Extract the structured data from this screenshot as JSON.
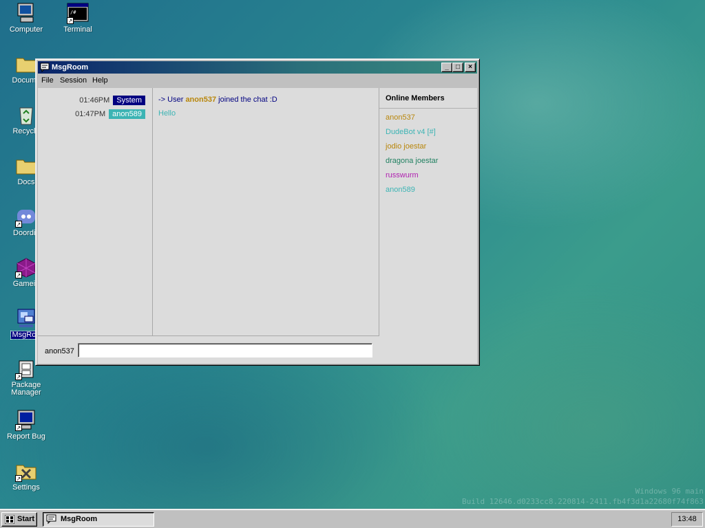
{
  "desktop": {
    "icons": [
      {
        "label": "Computer",
        "icon": "computer-icon"
      },
      {
        "label": "Terminal",
        "icon": "terminal-icon"
      },
      {
        "label": "Docume",
        "icon": "folder-icon"
      },
      {
        "label": "Recycle",
        "icon": "recycle-bin-icon"
      },
      {
        "label": "Docs",
        "icon": "folder-icon"
      },
      {
        "label": "Doordis",
        "icon": "discord-icon"
      },
      {
        "label": "Gamein",
        "icon": "game-icon"
      },
      {
        "label": "MsgRoo",
        "icon": "msgroom-icon"
      },
      {
        "label": "Package Manager",
        "icon": "package-manager-icon"
      },
      {
        "label": "Report Bug",
        "icon": "report-bug-icon"
      },
      {
        "label": "Settings",
        "icon": "settings-icon"
      }
    ],
    "watermark": {
      "line1": "Windows 96 main",
      "line2": "Build 12646.d0233cc8.220814-2411.fb4f3d1a22680f74f863"
    }
  },
  "window": {
    "title": "MsgRoom",
    "title_icon": "chat-bubble-icon",
    "controls": {
      "minimize": "_",
      "maximize": "□",
      "close": "×"
    },
    "menu": [
      "File",
      "Session",
      "Help"
    ],
    "messages": [
      {
        "time": "01:46PM",
        "author": "System",
        "author_color": "#000080",
        "prefix": "-> User ",
        "user": "anon537",
        "user_color": "#b8860b",
        "suffix": " joined the chat :D",
        "text_color": "#000080"
      },
      {
        "time": "01:47PM",
        "author": "anon589",
        "author_color": "#3cb4b4",
        "text": "Hello",
        "text_color": "#3cb4b4"
      }
    ],
    "members_title": "Online Members",
    "members": [
      {
        "name": "anon537",
        "color": "#b8860b"
      },
      {
        "name": "DudeBot v4 [#]",
        "color": "#3cb4b4"
      },
      {
        "name": "jodio joestar",
        "color": "#b8860b"
      },
      {
        "name": "dragona joestar",
        "color": "#208060"
      },
      {
        "name": "russwurm",
        "color": "#b020b0"
      },
      {
        "name": "anon589",
        "color": "#3cb4b4"
      }
    ],
    "composer": {
      "username": "anon537",
      "value": ""
    }
  },
  "taskbar": {
    "start_label": "Start",
    "task_label": "MsgRoom",
    "clock": "13:48"
  }
}
